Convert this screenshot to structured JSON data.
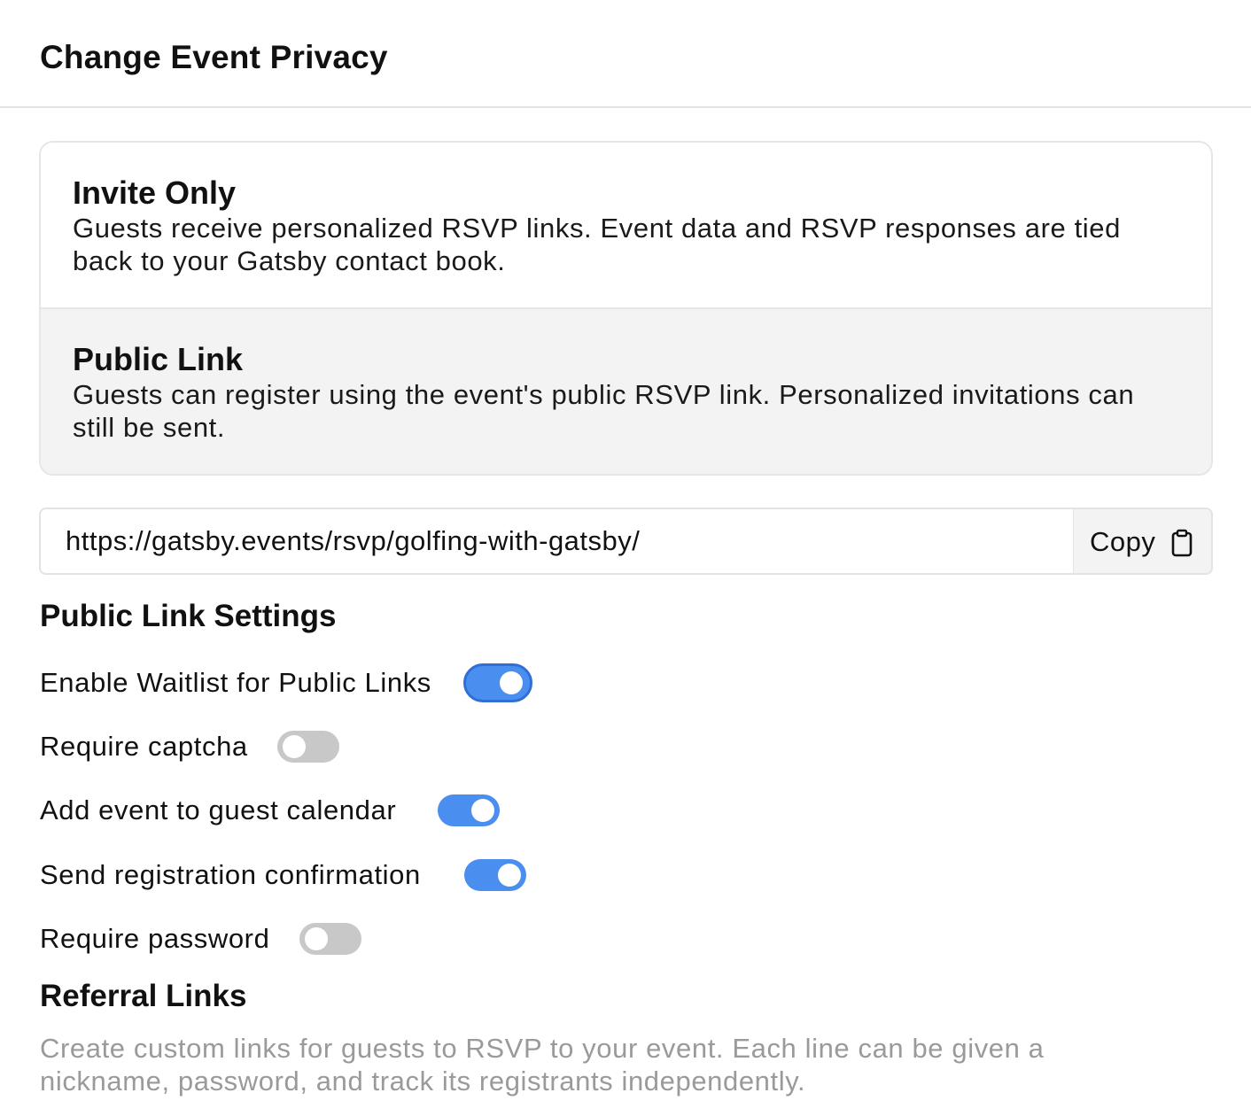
{
  "header": {
    "title": "Change Event Privacy"
  },
  "privacy_options": [
    {
      "title": "Invite Only",
      "description": "Guests receive personalized RSVP links. Event data and RSVP responses are tied back to your Gatsby contact book.",
      "selected": false
    },
    {
      "title": "Public Link",
      "description": "Guests can register using the event's public RSVP link. Personalized invitations can still be sent.",
      "selected": true
    }
  ],
  "public_link": {
    "url": "https://gatsby.events/rsvp/golfing-with-gatsby/",
    "copy_label": "Copy",
    "copy_icon": "clipboard-icon"
  },
  "public_link_settings": {
    "title": "Public Link Settings",
    "items": [
      {
        "label": "Enable Waitlist for Public Links",
        "enabled": true
      },
      {
        "label": "Require captcha",
        "enabled": false
      },
      {
        "label": "Add event to guest calendar",
        "enabled": true
      },
      {
        "label": "Send registration confirmation",
        "enabled": true
      },
      {
        "label": "Require password",
        "enabled": false
      }
    ]
  },
  "referral_links": {
    "title": "Referral Links",
    "description": "Create custom links for guests to RSVP to your event. Each line can be given a nickname, password, and track its registrants independently."
  },
  "colors": {
    "toggle_on": "#4a8ef0",
    "toggle_off": "#c8c8c8",
    "selected_option_bg": "#f3f3f3",
    "muted_text": "#9a9a9a"
  }
}
